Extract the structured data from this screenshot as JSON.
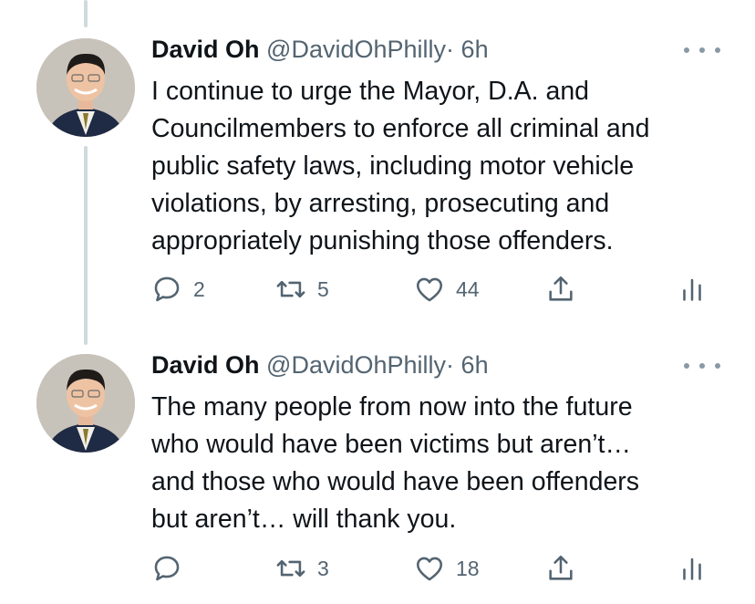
{
  "tweets": [
    {
      "author_name": "David Oh",
      "handle": "@DavidOhPhilly",
      "separator": "·",
      "time": "6h",
      "body_lines": [
        "I continue to urge the Mayor, D.A. and",
        "Councilmembers to enforce all criminal and",
        "public safety laws, including motor vehicle",
        "violations, by arresting, prosecuting and",
        "appropriately punishing those offenders."
      ],
      "replies": "2",
      "retweets": "5",
      "likes": "44"
    },
    {
      "author_name": "David Oh",
      "handle": "@DavidOhPhilly",
      "separator": "·",
      "time": "6h",
      "body_lines": [
        "The many people from now into the future",
        "who would have been victims but aren’t…",
        "and those who would have been offenders",
        "but aren’t… will thank you."
      ],
      "replies": "",
      "retweets": "3",
      "likes": "18"
    }
  ],
  "icons": {
    "reply": "reply-icon",
    "retweet": "retweet-icon",
    "like": "heart-icon",
    "share": "share-icon",
    "analytics": "analytics-icon",
    "more": "more-options-icon"
  },
  "colors": {
    "text": "#0f1419",
    "secondary": "#536471",
    "thread_line": "#cfd9de"
  }
}
